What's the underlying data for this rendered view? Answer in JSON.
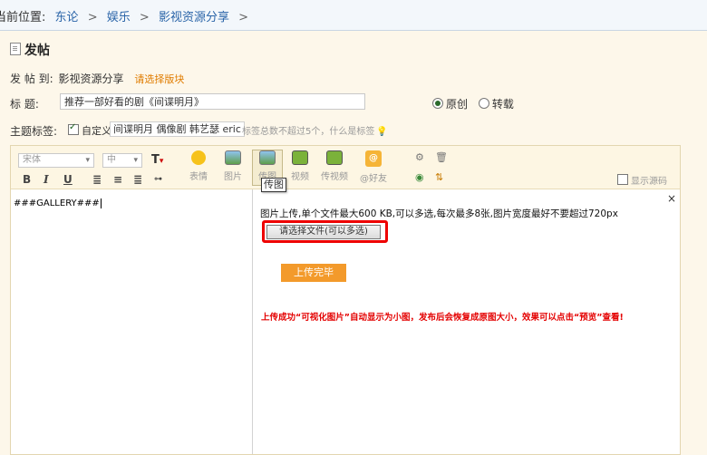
{
  "breadcrumb": {
    "prefix": "当前位置:",
    "items": [
      "东论",
      "娱乐",
      "影视资源分享"
    ],
    "separator": ">"
  },
  "page_title": "发帖",
  "post_to": {
    "label": "发 帖 到:",
    "forum": "影视资源分享",
    "choose_link": "请选择版块"
  },
  "title_field": {
    "label": "标  题:",
    "value": "推荐一部好看的剧《间谍明月》"
  },
  "post_type": {
    "original": "原创",
    "repost": "转载",
    "selected": "original"
  },
  "tags": {
    "label": "主题标签:",
    "custom_label": "自定义",
    "custom_checked": true,
    "value": "间谍明月 偶像剧 韩艺瑟 eric",
    "hint": "标签总数不超过5个，什么是标签"
  },
  "toolbar": {
    "font_family": "宋体",
    "font_size": "中",
    "bold": "B",
    "italic": "I",
    "underline": "U",
    "tools": [
      {
        "label": "表情",
        "icon": "smiley-icon"
      },
      {
        "label": "图片",
        "icon": "image-icon"
      },
      {
        "label": "传图",
        "icon": "upload-image-icon"
      },
      {
        "label": "视频",
        "icon": "video-icon"
      },
      {
        "label": "传视频",
        "icon": "upload-video-icon"
      },
      {
        "label": "@好友",
        "icon": "at-friend-icon"
      }
    ],
    "tooltip": "传图",
    "show_source": "显示源码"
  },
  "editor_content": "###GALLERY###",
  "upload_panel": {
    "info": "图片上传,单个文件最大600 KB,可以多选,每次最多8张,图片宽度最好不要超过720px",
    "choose_files": "请选择文件(可以多选)",
    "upload_done": "上传完毕",
    "success_note": "上传成功“可视化图片”自动显示为小图，发布后会恢复成原图大小，效果可以点击“预览”查看!",
    "close": "×"
  },
  "colors": {
    "link": "#2a64a8",
    "accent_orange": "#f39a2b",
    "alert_red": "#e40000",
    "page_bg": "#fdf7ea"
  }
}
